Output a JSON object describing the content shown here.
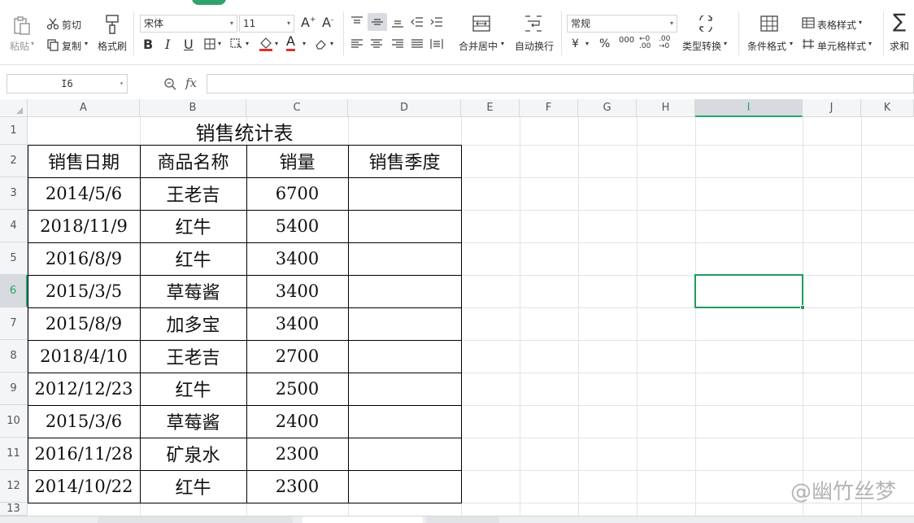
{
  "ribbon": {
    "paste_label": "粘贴",
    "cut_label": "剪切",
    "copy_label": "复制",
    "format_painter_label": "格式刷",
    "font_name": "宋体",
    "font_size": "11",
    "number_format": "常规",
    "merge_center_label": "合并居中",
    "wrap_text_label": "自动换行",
    "type_convert_label": "类型转换",
    "conditional_format_label": "条件格式",
    "table_style_label": "表格样式",
    "cell_style_label": "单元格样式",
    "sum_label": "求和"
  },
  "formula_bar": {
    "name_box": "I6",
    "fx": "fx",
    "value": ""
  },
  "columns": [
    "A",
    "B",
    "C",
    "D",
    "E",
    "F",
    "G",
    "H",
    "I",
    "J",
    "K"
  ],
  "rows": [
    "1",
    "2",
    "3",
    "4",
    "5",
    "6",
    "7",
    "8",
    "9",
    "10",
    "11",
    "12",
    "13"
  ],
  "sheet": {
    "title": "销售统计表",
    "headers": [
      "销售日期",
      "商品名称",
      "销量",
      "销售季度"
    ],
    "data": [
      [
        "2014/5/6",
        "王老吉",
        "6700",
        ""
      ],
      [
        "2018/11/9",
        "红牛",
        "5400",
        ""
      ],
      [
        "2016/8/9",
        "红牛",
        "3400",
        ""
      ],
      [
        "2015/3/5",
        "草莓酱",
        "3400",
        ""
      ],
      [
        "2015/8/9",
        "加多宝",
        "3400",
        ""
      ],
      [
        "2018/4/10",
        "王老吉",
        "2700",
        ""
      ],
      [
        "2012/12/23",
        "红牛",
        "2500",
        ""
      ],
      [
        "2015/3/6",
        "草莓酱",
        "2400",
        ""
      ],
      [
        "2016/11/28",
        "矿泉水",
        "2300",
        ""
      ],
      [
        "2014/10/22",
        "红牛",
        "2300",
        ""
      ]
    ]
  },
  "watermark": "@幽竹丝梦",
  "colors": {
    "accent": "#2fa36b",
    "selection": "#1f9a5e"
  }
}
